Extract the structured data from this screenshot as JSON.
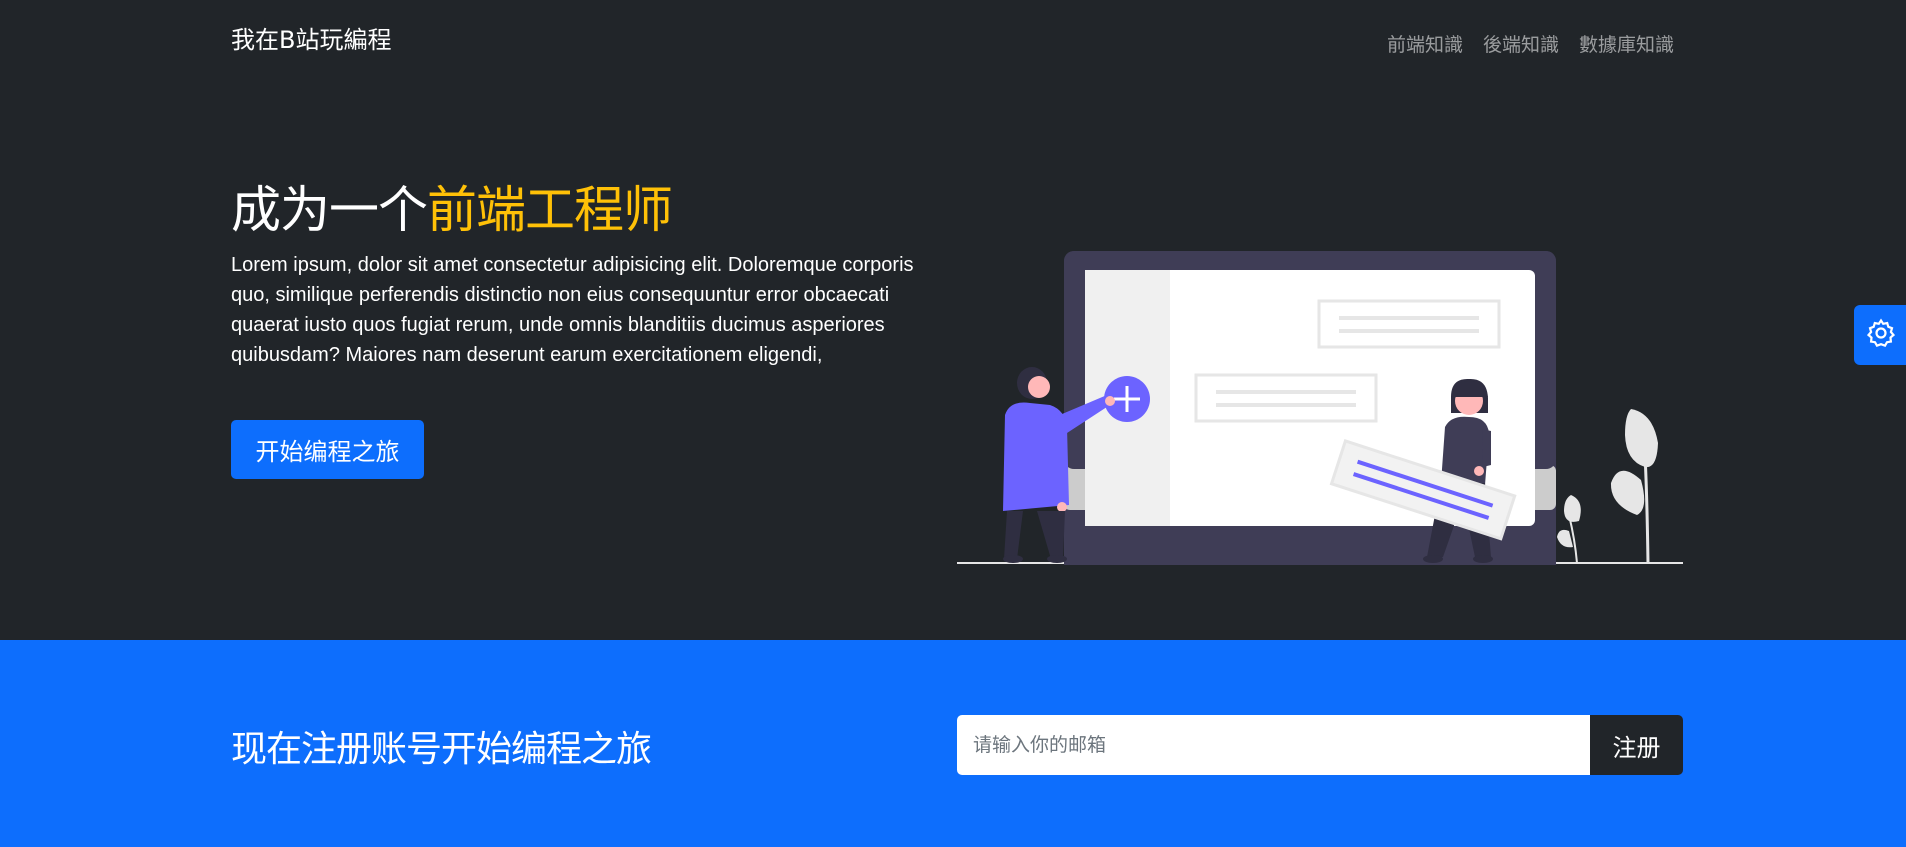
{
  "navbar": {
    "brand": "我在B站玩編程",
    "links": [
      {
        "label": "前端知識"
      },
      {
        "label": "後端知識"
      },
      {
        "label": "數據庫知識"
      }
    ]
  },
  "hero": {
    "title_prefix": "成为一个",
    "title_accent": "前端工程师",
    "text": "Lorem ipsum, dolor sit amet consectetur adipisicing elit. Doloremque corporis quo, similique perferendis distinctio non eius consequuntur error obcaecati quaerat iusto quos fugiat rerum, unde omnis blanditiis ducimus asperiores quibusdam? Maiores nam deserunt earum exercitationem eligendi,",
    "button_label": "开始编程之旅",
    "illustration_icon": "plus-icon"
  },
  "settings": {
    "icon": "gear-icon"
  },
  "signup": {
    "title": "现在注册账号开始编程之旅",
    "email_placeholder": "请输入你的邮箱",
    "email_value": "",
    "button_label": "注册"
  },
  "colors": {
    "dark": "#212529",
    "primary": "#0d6efd",
    "accent": "#ffc107",
    "illustration_purple": "#6c63ff"
  }
}
